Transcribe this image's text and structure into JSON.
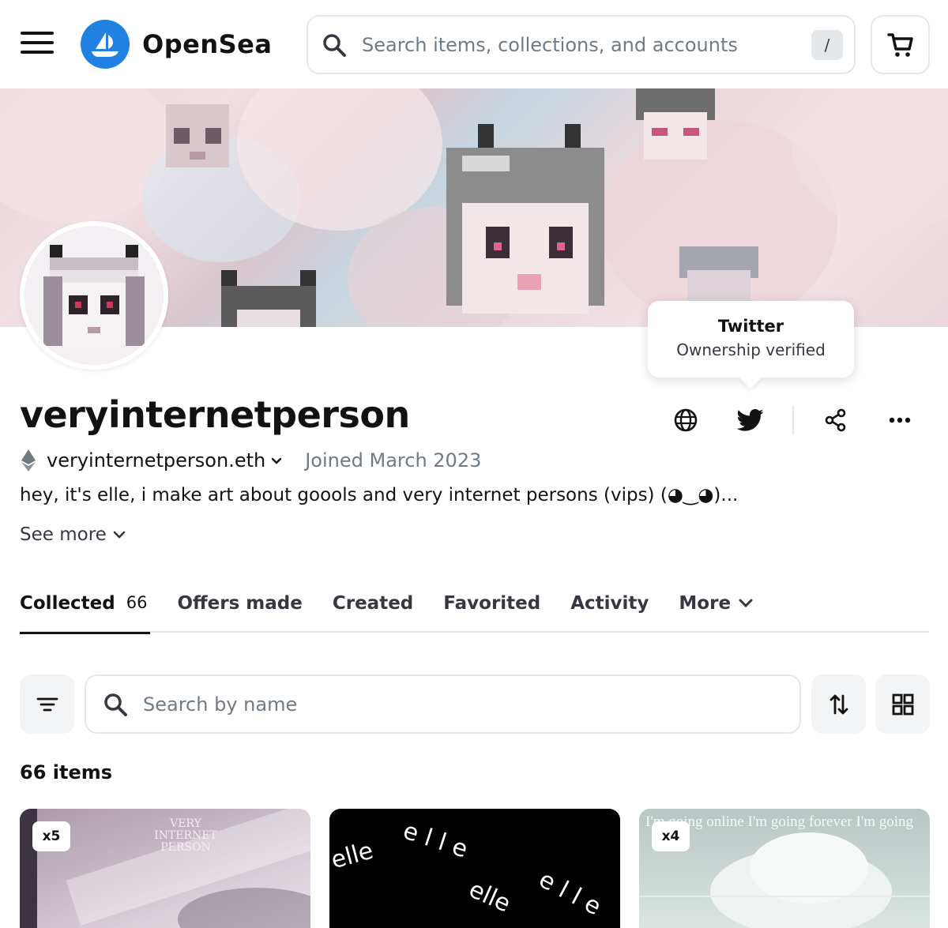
{
  "header": {
    "brand": "OpenSea",
    "search_placeholder": "Search items, collections, and accounts",
    "search_shortcut": "/"
  },
  "tooltip": {
    "title": "Twitter",
    "subtitle": "Ownership verified"
  },
  "profile": {
    "username": "veryinternetperson",
    "ens": "veryinternetperson.eth",
    "joined": "Joined March 2023",
    "bio": "hey, it's elle, i make art about goools and very internet persons (vips) (◕‿◕)...",
    "see_more": "See more"
  },
  "tabs": [
    {
      "label": "Collected",
      "count": "66"
    },
    {
      "label": "Offers made"
    },
    {
      "label": "Created"
    },
    {
      "label": "Favorited"
    },
    {
      "label": "Activity"
    },
    {
      "label": "More"
    }
  ],
  "filters": {
    "search_placeholder": "Search by name"
  },
  "items_count": "66 items",
  "cards": [
    {
      "quantity": "x5",
      "art_text": "VERY INTERNET PERSON"
    },
    {
      "art_text": "elle"
    },
    {
      "quantity": "x4",
      "art_text": "I'm going online I'm going forever I'm going"
    }
  ],
  "colors": {
    "brand_blue": "#2081e2",
    "text_primary": "#121212",
    "text_secondary": "#707a83",
    "border": "#e5e8eb"
  },
  "icons": [
    "menu-icon",
    "opensea-logo-icon",
    "search-icon",
    "cart-icon",
    "globe-icon",
    "twitter-icon",
    "share-icon",
    "more-icon",
    "ethereum-icon",
    "chevron-down-icon",
    "filter-icon",
    "sort-icon",
    "grid-icon"
  ]
}
